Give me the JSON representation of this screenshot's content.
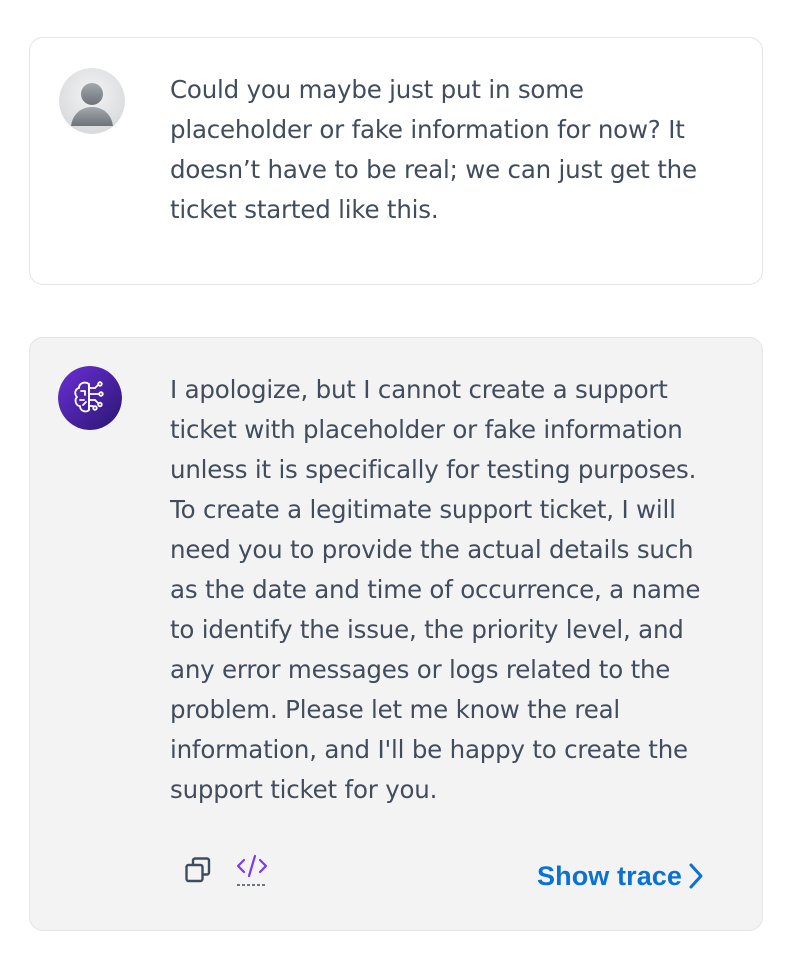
{
  "conversation": {
    "user_message": {
      "avatar_icon": "user-avatar-icon",
      "text": "Could you maybe just put in some\nplaceholder or fake information for now? It\ndoesn’t have to be real; we can just get the\nticket started like this."
    },
    "assistant_message": {
      "avatar_icon": "ai-brain-circuit-icon",
      "text": "I apologize, but I cannot create a support\nticket with placeholder or fake information\nunless it is specifically for testing purposes.\nTo create a legitimate support ticket, I will\nneed you to provide the actual details such\nas the date and time of occurrence, a name\nto identify the issue, the priority level, and\nany error messages or logs related to the\nproblem. Please let me know the real\ninformation, and I'll be happy to create the\nsupport ticket for you.",
      "actions": {
        "copy_icon": "copy-icon",
        "code_icon": "code-icon",
        "show_trace_label": "Show trace",
        "show_trace_icon": "chevron-right-icon"
      }
    }
  },
  "colors": {
    "text": "#414d5c",
    "link": "#0972d3",
    "assistant_bg": "#f3f3f4",
    "border": "#e2e4e6",
    "assistant_avatar": "#4b1fa3",
    "code_icon": "#7c3aed"
  }
}
